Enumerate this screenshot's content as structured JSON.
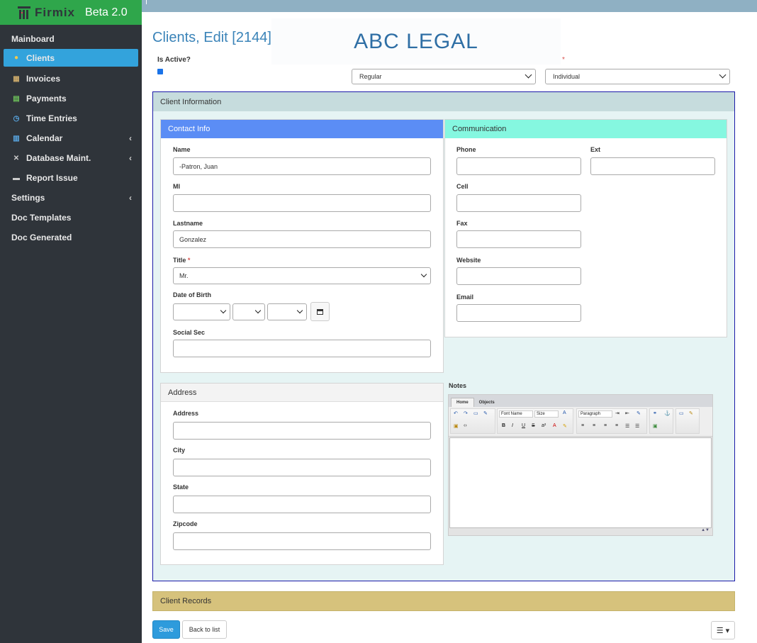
{
  "brand": {
    "name": "Firmix",
    "version": "Beta 2.0"
  },
  "nav": [
    {
      "label": "Mainboard",
      "icon": "",
      "chevron": false,
      "active": false
    },
    {
      "label": "Clients",
      "icon": "person-icon",
      "chevron": false,
      "active": true
    },
    {
      "label": "Invoices",
      "icon": "cash-register-icon",
      "chevron": false,
      "active": false
    },
    {
      "label": "Payments",
      "icon": "money-icon",
      "chevron": false,
      "active": false
    },
    {
      "label": "Time Entries",
      "icon": "clock-icon",
      "chevron": false,
      "active": false
    },
    {
      "label": "Calendar",
      "icon": "calendar-icon",
      "chevron": true,
      "active": false
    },
    {
      "label": "Database Maint.",
      "icon": "tools-icon",
      "chevron": true,
      "active": false
    },
    {
      "label": "Report Issue",
      "icon": "comment-icon",
      "chevron": false,
      "active": false
    },
    {
      "label": "Settings",
      "icon": "",
      "chevron": true,
      "active": false
    },
    {
      "label": "Doc Templates",
      "icon": "",
      "chevron": false,
      "active": false
    },
    {
      "label": "Doc Generated",
      "icon": "",
      "chevron": false,
      "active": false
    }
  ],
  "header": {
    "title": "Clients, Edit [2144]",
    "firm_logo": "ABC LEGAL",
    "is_active_label": "Is Active?",
    "is_active": true,
    "client_type": "Regular",
    "entity_type": "Individual"
  },
  "client_info": {
    "title": "Client Information",
    "contact": {
      "title": "Contact Info",
      "name_label": "Name",
      "name_value": "-Patron, Juan",
      "mi_label": "MI",
      "mi_value": "",
      "lastname_label": "Lastname",
      "lastname_value": "Gonzalez",
      "title_label": "Title",
      "title_value": "Mr.",
      "dob_label": "Date of Birth",
      "ssn_label": "Social Sec",
      "ssn_value": ""
    },
    "communication": {
      "title": "Communication",
      "phone_label": "Phone",
      "phone_value": "",
      "ext_label": "Ext",
      "ext_value": "",
      "cell_label": "Cell",
      "cell_value": "",
      "fax_label": "Fax",
      "fax_value": "",
      "website_label": "Website",
      "website_value": "",
      "email_label": "Email",
      "email_value": ""
    },
    "address": {
      "title": "Address",
      "address_label": "Address",
      "address_value": "",
      "city_label": "City",
      "city_value": "",
      "state_label": "State",
      "state_value": "",
      "zip_label": "Zipcode",
      "zip_value": ""
    },
    "notes": {
      "label": "Notes",
      "tabs": [
        "Home",
        "Objects"
      ],
      "font_name": "Font Name",
      "size": "Size",
      "paragraph": "Paragraph"
    }
  },
  "client_records": {
    "title": "Client Records"
  },
  "actions": {
    "save": "Save",
    "back": "Back to list",
    "menu": "☰ ▾"
  },
  "colors": {
    "sidebar": "#2f343a",
    "brand": "#2fa64b",
    "active_nav": "#33a3dc",
    "contact_head": "#5b8df5",
    "comm_head": "#85f7e0",
    "records_head": "#d6c27c"
  }
}
